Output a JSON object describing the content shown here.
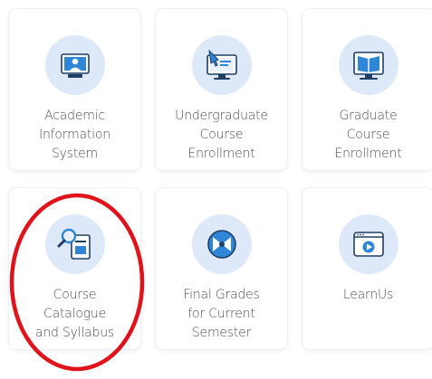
{
  "tiles": [
    {
      "id": "academic-information-system",
      "icon": "computer-user-icon",
      "label_lines": [
        "Academic",
        "Information",
        "System"
      ]
    },
    {
      "id": "undergraduate-course-enrollment",
      "icon": "monitor-pointer-icon",
      "label_lines": [
        "Undergraduate",
        "Course",
        "Enrollment"
      ]
    },
    {
      "id": "graduate-course-enrollment",
      "icon": "monitor-book-icon",
      "label_lines": [
        "Graduate",
        "Course",
        "Enrollment"
      ]
    },
    {
      "id": "course-catalogue-and-syllabus",
      "icon": "search-document-icon",
      "label_lines": [
        "Course",
        "Catalogue",
        "and Syllabus"
      ]
    },
    {
      "id": "final-grades-for-current-semester",
      "icon": "grade-circle-icon",
      "label_lines": [
        "Final Grades",
        "for Current",
        "Semester"
      ]
    },
    {
      "id": "learnus",
      "icon": "browser-play-icon",
      "label_lines": [
        "LearnUs"
      ]
    }
  ],
  "colors": {
    "icon_bg": "#dde9f8",
    "icon_primary": "#2f86d6",
    "icon_dark": "#1f3f66",
    "highlight": "#e0131a"
  }
}
